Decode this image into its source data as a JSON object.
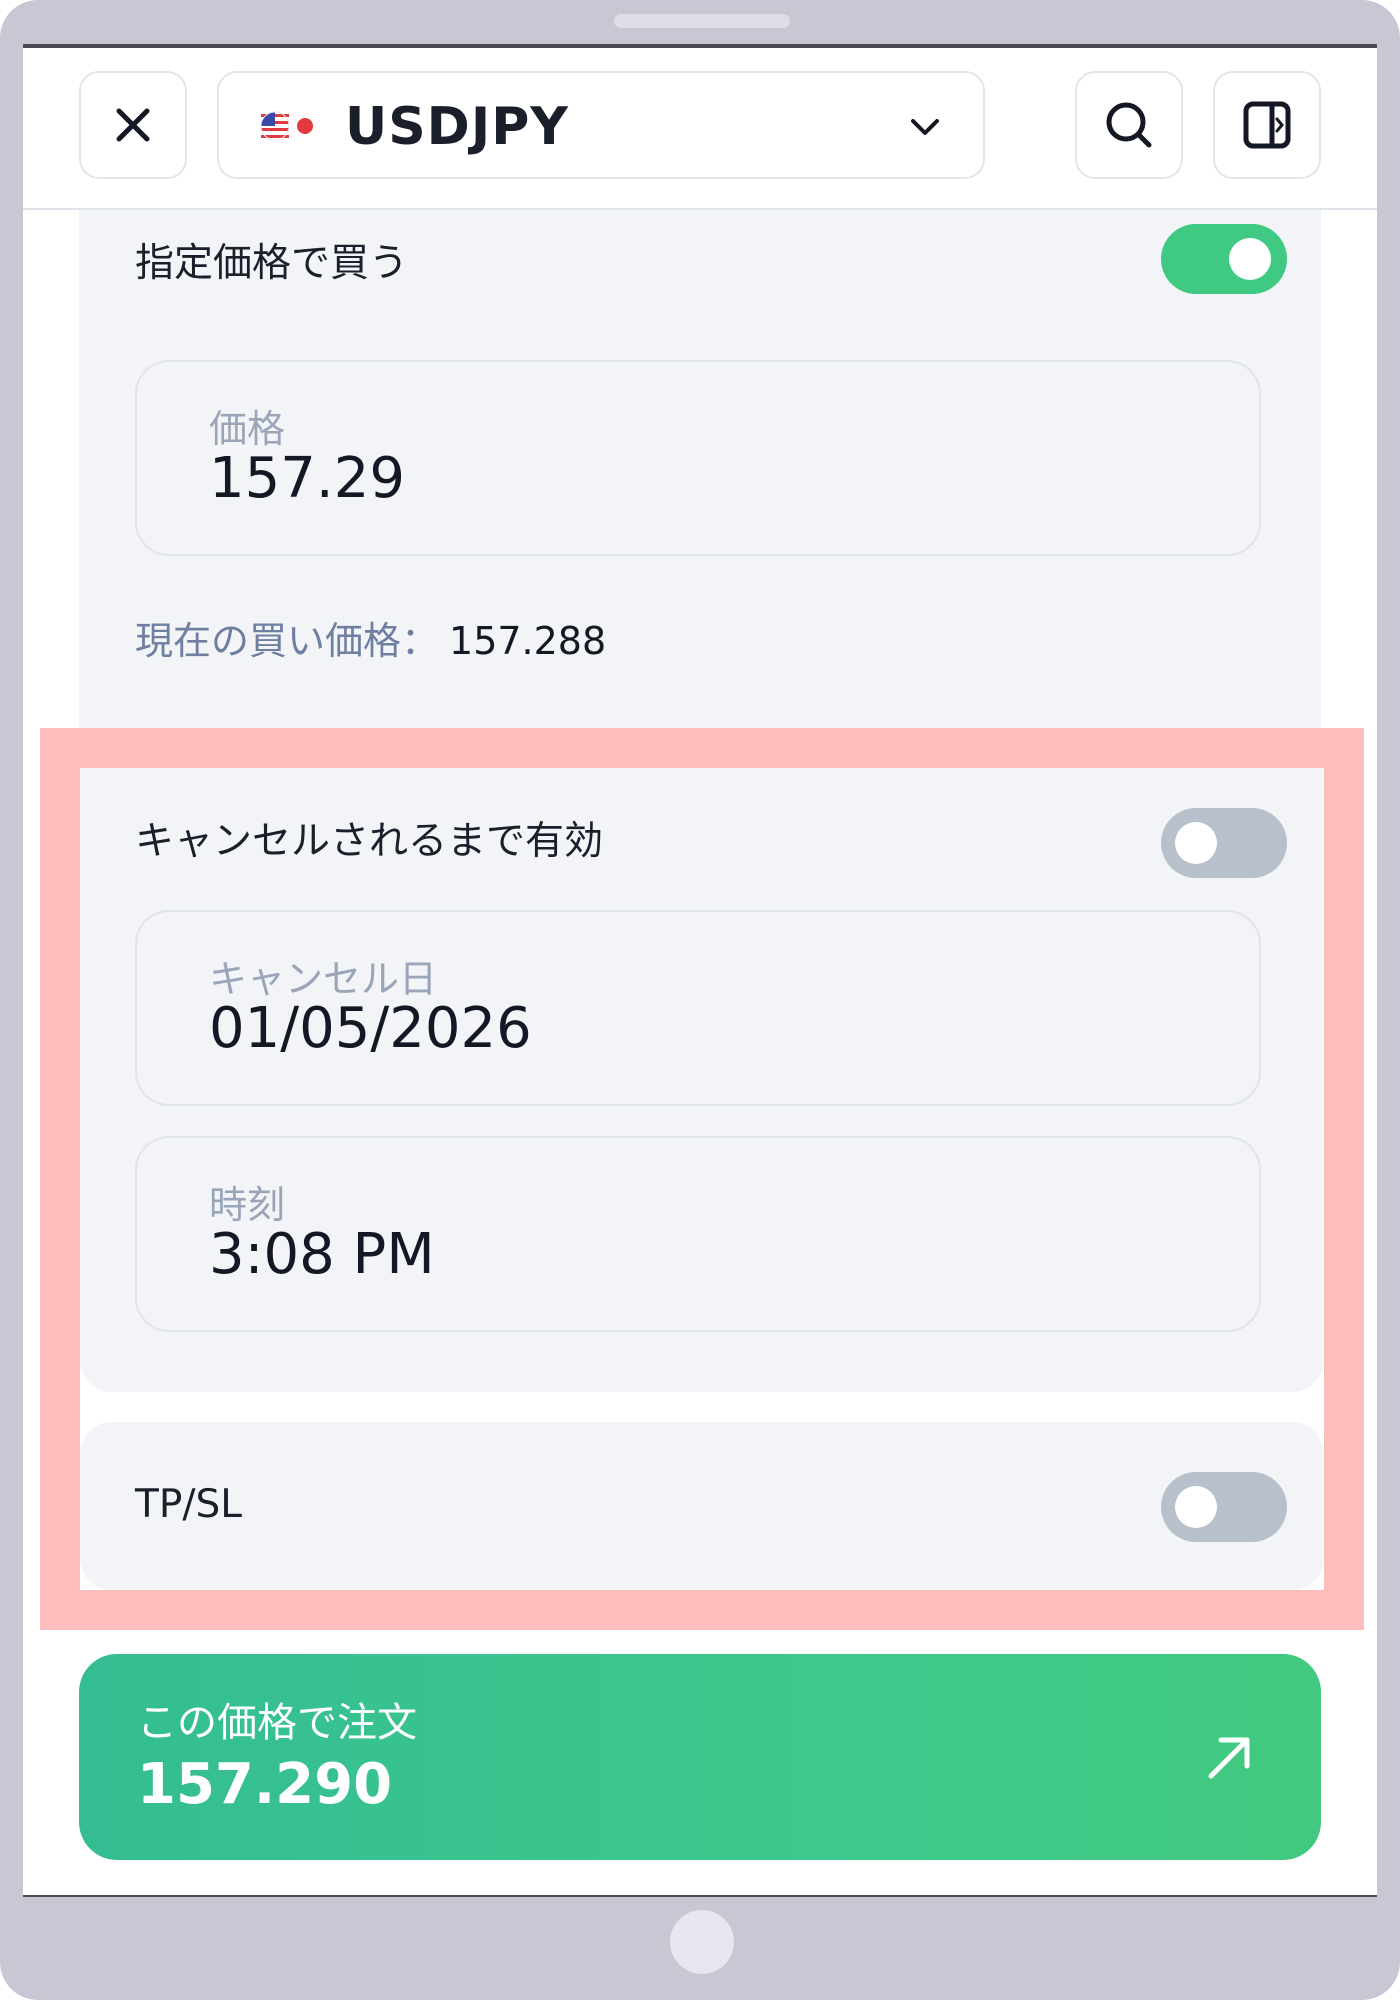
{
  "header": {
    "pair_symbol": "USDJPY",
    "close_icon": "close-icon",
    "search_icon": "search-icon",
    "panel_icon": "side-panel-icon"
  },
  "limit_order": {
    "label": "指定価格で買う",
    "enabled": true,
    "price_label": "価格",
    "price_value": "157.29",
    "current_label": "現在の買い価格：",
    "current_value": "157.288"
  },
  "expiry": {
    "gtc_label": "キャンセルされるまで有効",
    "gtc_enabled": false,
    "date_label": "キャンセル日",
    "date_value": "01/05/2026",
    "time_label": "時刻",
    "time_value": "3:08 PM"
  },
  "tpsl": {
    "label": "TP/SL",
    "enabled": false
  },
  "order_button": {
    "label": "この価格で注文",
    "value": "157.290"
  },
  "colors": {
    "toggle_on": "#3fc982",
    "toggle_off": "#b8c0cc",
    "highlight": "#ffbcbc",
    "accent": "#3dc98c"
  }
}
